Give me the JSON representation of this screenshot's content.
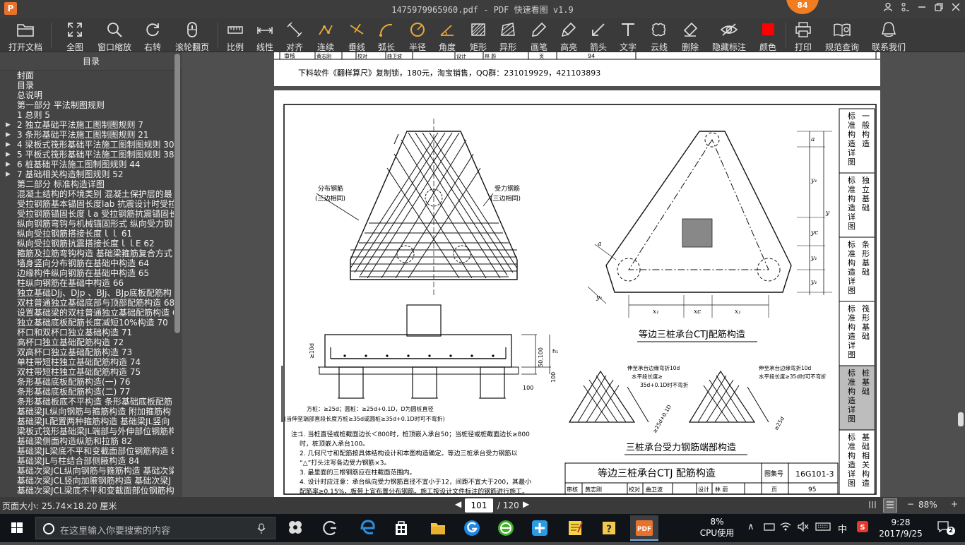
{
  "window": {
    "title": "1475979965960.pdf - PDF 快速看图 v1.9",
    "badge": "84",
    "logo": "P"
  },
  "toolbar": {
    "items": [
      {
        "label": "打开文档",
        "icon": "folder-icon"
      },
      {
        "label": "全图",
        "icon": "fit-all-icon"
      },
      {
        "label": "窗口缩放",
        "icon": "zoom-window-icon"
      },
      {
        "label": "右转",
        "icon": "rotate-right-icon"
      },
      {
        "label": "滚轮翻页",
        "icon": "mouse-wheel-icon"
      },
      {
        "label": "比例",
        "icon": "scale-ruler-icon"
      },
      {
        "label": "线性",
        "icon": "linear-measure-icon"
      },
      {
        "label": "对齐",
        "icon": "align-measure-icon"
      },
      {
        "label": "连续",
        "icon": "continuous-measure-icon"
      },
      {
        "label": "垂线",
        "icon": "perpendicular-icon"
      },
      {
        "label": "弧长",
        "icon": "arc-length-icon"
      },
      {
        "label": "半径",
        "icon": "radius-icon"
      },
      {
        "label": "角度",
        "icon": "angle-icon"
      },
      {
        "label": "矩形",
        "icon": "rectangle-area-icon"
      },
      {
        "label": "异形",
        "icon": "polygon-area-icon"
      },
      {
        "label": "画笔",
        "icon": "pen-icon"
      },
      {
        "label": "高亮",
        "icon": "highlighter-icon"
      },
      {
        "label": "箭头",
        "icon": "arrow-icon"
      },
      {
        "label": "文字",
        "icon": "text-icon"
      },
      {
        "label": "云线",
        "icon": "cloud-line-icon"
      },
      {
        "label": "删除",
        "icon": "eraser-icon"
      },
      {
        "label": "隐藏标注",
        "icon": "hide-annotation-icon"
      },
      {
        "label": "颜色",
        "icon": "color-swatch-icon"
      },
      {
        "label": "打印",
        "icon": "printer-icon"
      },
      {
        "label": "规范查询",
        "icon": "book-search-icon"
      },
      {
        "label": "联系我们",
        "icon": "contact-icon"
      }
    ],
    "color_swatch": "#ff0000"
  },
  "sidebar": {
    "title": "目录",
    "items": [
      {
        "label": "封面",
        "expandable": false
      },
      {
        "label": "目录",
        "expandable": false
      },
      {
        "label": "总说明",
        "expandable": false
      },
      {
        "label": "第一部分  平法制图规则",
        "expandable": false
      },
      {
        "label": "1 总则 5",
        "expandable": false
      },
      {
        "label": "2 独立基础平法施工图制图规则 7",
        "expandable": true
      },
      {
        "label": "3 条形基础平法施工图制图规则 21",
        "expandable": true
      },
      {
        "label": "4 梁板式筏形基础平法施工图制图规则 30",
        "expandable": true
      },
      {
        "label": "5 平板式筏形基础平法施工图制图规则 38",
        "expandable": true
      },
      {
        "label": "6 桩基础平法施工图制图规则 44",
        "expandable": true
      },
      {
        "label": "7 基础相关构造制图规则 52",
        "expandable": true
      },
      {
        "label": "第二部分  标准构造详图",
        "expandable": false
      },
      {
        "label": "混凝土结构的环境类别 混凝土保护层的最",
        "expandable": false
      },
      {
        "label": "受拉钢筋基本锚固长度lab 抗震设计时受拉",
        "expandable": false
      },
      {
        "label": "受拉钢筋锚固长度ｌa 受拉钢筋抗震锚固长",
        "expandable": false
      },
      {
        "label": "纵向钢筋弯钩与机械锚固形式 纵向受力钢",
        "expandable": false
      },
      {
        "label": "纵向受拉钢筋搭接长度ｌｌ 61",
        "expandable": false
      },
      {
        "label": "纵向受拉钢筋抗震搭接长度ｌｌE 62",
        "expandable": false
      },
      {
        "label": "箍筋及拉筋弯钩构造 基础梁箍筋复合方式",
        "expandable": false
      },
      {
        "label": "墙身竖向分布钢筋在基础中构造 64",
        "expandable": false
      },
      {
        "label": "边缘构件纵向钢筋在基础中构造 65",
        "expandable": false
      },
      {
        "label": "柱纵向钢筋在基础中构造 66",
        "expandable": false
      },
      {
        "label": "独立基础DJj、DJp 、BJj、BJp底板配筋构",
        "expandable": false
      },
      {
        "label": "双柱普通独立基础底部与顶部配筋构造 68",
        "expandable": false
      },
      {
        "label": "设置基础梁的双柱普通独立基础配筋构造 6",
        "expandable": false
      },
      {
        "label": "独立基础底板配筋长度减短10%构造 70",
        "expandable": false
      },
      {
        "label": "杯口和双杯口独立基础构造 71",
        "expandable": false
      },
      {
        "label": "高杯口独立基础配筋构造 72",
        "expandable": false
      },
      {
        "label": "双高杯口独立基础配筋构造 73",
        "expandable": false
      },
      {
        "label": "单柱带短柱独立基础配筋构造 74",
        "expandable": false
      },
      {
        "label": "双柱带短柱独立基础配筋构造 75",
        "expandable": false
      },
      {
        "label": "条形基础底板配筋构造(一) 76",
        "expandable": false
      },
      {
        "label": "条形基础底板配筋构造(二) 77",
        "expandable": false
      },
      {
        "label": "条形基础板底不平构造 条形基础底板配筋",
        "expandable": false
      },
      {
        "label": "基础梁JL纵向钢筋与箍筋构造 附加箍筋构",
        "expandable": false
      },
      {
        "label": "基础梁JL配置两种箍筋构造 基础梁JL竖向",
        "expandable": false
      },
      {
        "label": "梁板式筏形基础梁JL端部与外伸部位钢筋构",
        "expandable": false
      },
      {
        "label": "基础梁侧面构造纵筋和拉筋 82",
        "expandable": false
      },
      {
        "label": "基础梁JL梁底不平和变截面部位钢筋构造 8",
        "expandable": false
      },
      {
        "label": "基础梁JL与柱结合部侧腋构造 84",
        "expandable": false
      },
      {
        "label": "基础次梁JCL纵向钢筋与箍筋构造 基础次梁",
        "expandable": false
      },
      {
        "label": "基础次梁JCL竖向加腋钢筋构造 基础次梁J",
        "expandable": false
      },
      {
        "label": "基础次梁JCL梁底不平和变截面部位钢筋构",
        "expandable": false
      }
    ]
  },
  "document": {
    "top_page": {
      "footer_text": "下料软件《翻样算尺》复制锁，180元，淘宝销售，QQ群：231019929，421103893",
      "strip": {
        "a": "审核",
        "b": "黄志刚",
        "c": "校对",
        "d": "曲卫波",
        "e": "设计",
        "f": "林  蔚",
        "g": "页",
        "h": "94"
      }
    },
    "main_page": {
      "label_dist": "分布钢筋",
      "label_dist2": "(三边相同)",
      "label_force": "受力钢筋",
      "label_force2": "(三边相同)",
      "dim_10d": "≥10d",
      "dim_50100": "50,100",
      "dim_h1": "h₁",
      "dim_100a": "100",
      "dim_100b": "100",
      "note_small1": "方桩：≥25d；圆桩：≥25d+0.1D，D为圆桩直径",
      "note_small2": "(当伸至端部直段长度方桩≥35d或圆桩≥35d+0.1D时可不弯折)",
      "title_right1": "等边三桩承台CTJ配筋构造",
      "dim_a1": "a",
      "dim_a2": "a",
      "dim_y1": "y₁",
      "dim_yc": "yc",
      "dim_y2": "y₁",
      "dim_y3": "y₁",
      "dim_y": "y",
      "dim_y1b": "y₁",
      "dim_x1": "x₁",
      "dim_xc": "xc",
      "dim_x2": "x₁",
      "end_note1": "伸至承台边缘弯折10d",
      "end_note2": "水平段长度≥",
      "end_note3": "35d+0.1D时不弯折",
      "end_note4": "伸至承台边缘弯折10d",
      "end_note5": "水平段长度≥35d时可不弯折",
      "end_dim1": "≥25d+0.1D",
      "end_dim2": "≥25d",
      "title_bottom": "三桩承台受力钢筋端部构造",
      "notes_label": "注：",
      "notes": [
        "1. 当桩直径或桩截面边长＜800时，桩顶嵌入承台50；当桩径或桩截面边长≥800",
        "   时，桩顶嵌入承台100。",
        "2. 几何尺寸和配筋按具体结构设计和本图构造确定。等边三桩承台受力钢筋以",
        "   “△”打头注写各边受力钢筋×3。",
        "3. 最里面的三根钢筋应在柱截面范围内。",
        "4. 设计时应注意：承台纵向受力钢筋直径不宜小于12，间距不宜大于200，其最小",
        "   配筋率≥0.15%，板带上宜布置分布钢筋。施工按设计文件标注的钢筋进行施工。"
      ],
      "title_block": {
        "title": "等边三桩承台CTJ 配筋构造",
        "atlas_label": "图集号",
        "atlas_no": "16G101-3",
        "s1": "审核",
        "s2": "黄志刚",
        "s3": "校对",
        "s4": "曲卫波",
        "s5": "设计",
        "s6": "林  蔚",
        "s7": "页",
        "page": "95"
      },
      "side_tabs": [
        {
          "a": "标准构造详图",
          "b": "一般构造"
        },
        {
          "a": "标准构造详图",
          "b": "独立基础"
        },
        {
          "a": "标准构造详图",
          "b": "条形基础"
        },
        {
          "a": "标准构造详图",
          "b": "筏形基础"
        },
        {
          "a": "标准构造详图",
          "b": "桩基础"
        },
        {
          "a": "标准构造详图",
          "b": "基础相关构造"
        }
      ]
    }
  },
  "status": {
    "page_size": "页面大小: 25.74×18.20 厘米",
    "current_page": "101",
    "total_pages": "/ 120",
    "zoom": "88%"
  },
  "taskbar": {
    "search_placeholder": "在这里输入你要搜索的内容",
    "cpu_percent": "8%",
    "cpu_label": "CPU使用",
    "ime": "中",
    "time": "9:28",
    "date": "2017/9/25",
    "notifications": "2"
  }
}
